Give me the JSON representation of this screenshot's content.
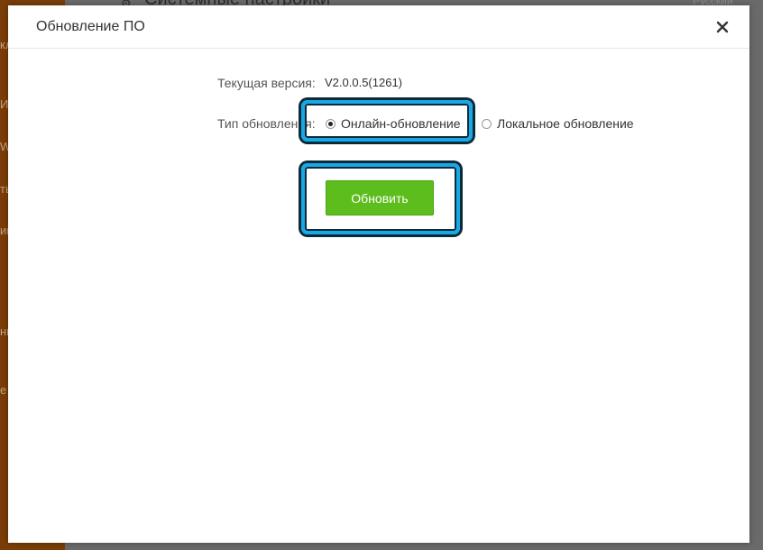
{
  "background": {
    "page_title": "Системные настройки",
    "language": "Русский",
    "sidebar_fragments": [
      "кл",
      "И",
      "W",
      "ть",
      "ий",
      "ны",
      "е"
    ]
  },
  "dialog": {
    "title": "Обновление ПО",
    "current_version_label": "Текущая версия:",
    "current_version_value": "V2.0.0.5(1261)",
    "update_type_label": "Тип обновления:",
    "options": [
      {
        "label": "Онлайн-обновление",
        "selected": true
      },
      {
        "label": "Локальное обновление",
        "selected": false
      }
    ],
    "update_button": "Обновить"
  },
  "colors": {
    "accent_button": "#5cbd1c",
    "highlight": "#18a8e8",
    "sidebar": "#7a3d08"
  },
  "icons": {
    "close": "close-icon",
    "gear": "gear-icon"
  }
}
